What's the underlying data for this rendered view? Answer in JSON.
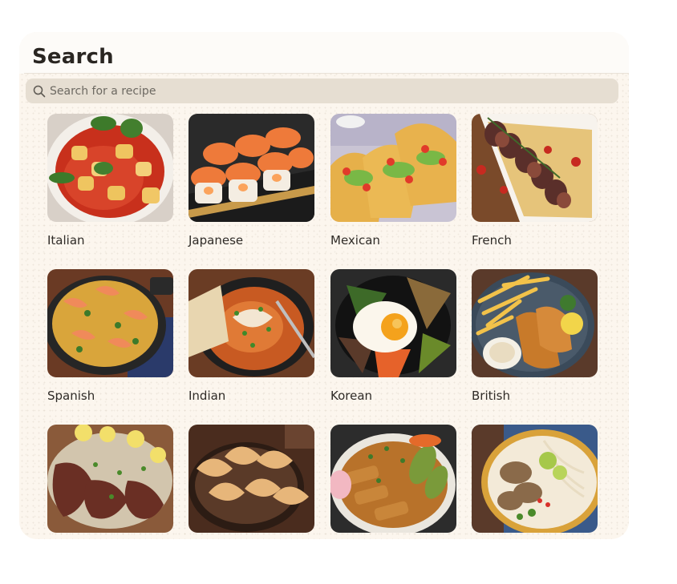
{
  "header": {
    "title": "Search"
  },
  "search": {
    "placeholder": "Search for a recipe",
    "value": ""
  },
  "cuisines": [
    {
      "label": "Italian"
    },
    {
      "label": "Japanese"
    },
    {
      "label": "Mexican"
    },
    {
      "label": "French"
    },
    {
      "label": "Spanish"
    },
    {
      "label": "Indian"
    },
    {
      "label": "Korean"
    },
    {
      "label": "British"
    },
    {
      "label": ""
    },
    {
      "label": ""
    },
    {
      "label": ""
    },
    {
      "label": ""
    }
  ]
}
